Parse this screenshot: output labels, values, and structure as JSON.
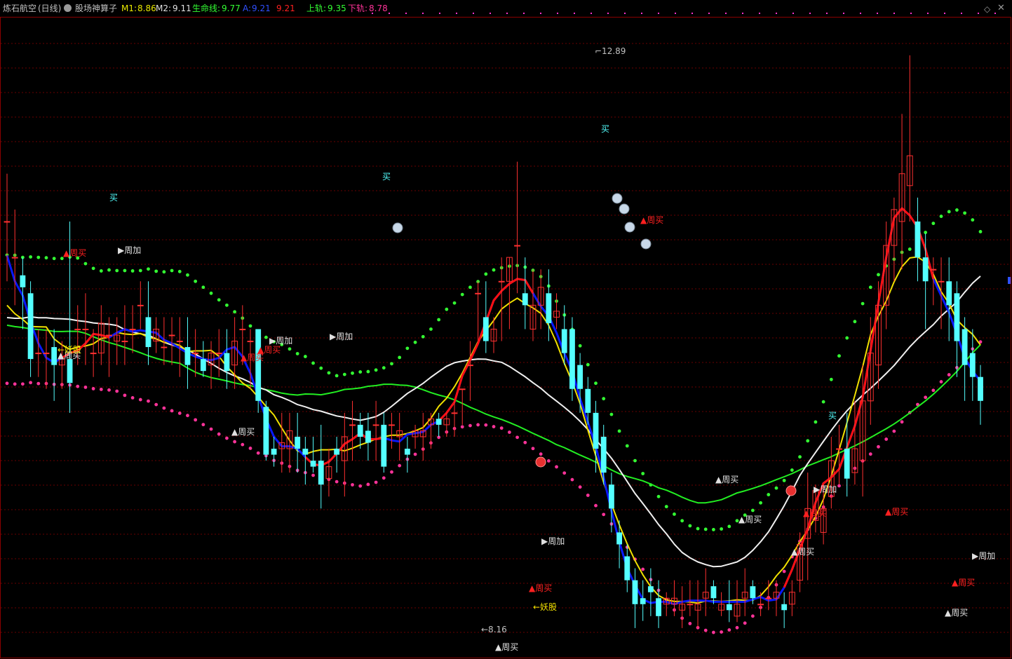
{
  "header": {
    "stock_name": "炼石航空",
    "period": "(日线)",
    "indicator": "股场神算子",
    "m1_label": "M1:",
    "m1_value": "8.86",
    "m2_label": "M2:",
    "m2_value": "9.11",
    "life_label": "生命线:",
    "life_value": "9.77",
    "a_label": "A:",
    "a_value": "9.21",
    "a2_value": "9.21",
    "upper_label": "上轨:",
    "upper_value": "9.35",
    "lower_label": "下轨:",
    "lower_value": "8.78",
    "colors": {
      "stock": "#c0c0c0",
      "m1": "#e8e800",
      "m2": "#e0e0e0",
      "life": "#33ff33",
      "a": "#3050ff",
      "a2": "#ff2020",
      "upper": "#33ff33",
      "lower": "#ff3399"
    }
  },
  "window_controls": {
    "diamond_icon": "diamond-icon",
    "close_icon": "close-icon"
  },
  "chart_data": {
    "type": "candlestick",
    "annotations": {
      "high_value": "12.89",
      "low_value": "8.16",
      "buy": "买",
      "week_buy": "周买",
      "week_add": "周加",
      "demon": "妖股"
    },
    "price_range": [
      7.9,
      13.2
    ],
    "colors": {
      "up": "#ff3030",
      "down": "#54ffff",
      "grid": "#6a0000",
      "ma_white": "#f0f0f0",
      "ma_yellow": "#f0e000",
      "ma_green": "#22ee22",
      "ma_blue": "#0818ff",
      "ma_red": "#ff1010",
      "dots_green": "#33ff33",
      "dots_pink": "#ff3399"
    },
    "candles": [
      [
        11.5,
        11.5,
        11.0,
        11.9
      ],
      [
        11.2,
        11.2,
        10.8,
        11.6
      ],
      [
        11.05,
        10.95,
        10.6,
        11.2
      ],
      [
        10.9,
        10.35,
        10.2,
        11.0
      ],
      [
        10.4,
        10.4,
        10.2,
        10.6
      ],
      [
        10.4,
        10.4,
        10.1,
        10.6
      ],
      [
        10.45,
        10.3,
        10.0,
        10.6
      ],
      [
        10.3,
        10.35,
        10.1,
        10.5
      ],
      [
        10.35,
        10.15,
        9.9,
        11.5
      ],
      [
        10.6,
        10.6,
        10.3,
        10.8
      ],
      [
        10.6,
        10.6,
        10.3,
        10.9
      ],
      [
        10.4,
        10.4,
        10.2,
        10.6
      ],
      [
        10.4,
        10.65,
        10.3,
        10.8
      ],
      [
        10.55,
        10.55,
        10.2,
        10.7
      ],
      [
        10.5,
        10.55,
        10.3,
        10.7
      ],
      [
        10.5,
        10.5,
        10.3,
        10.8
      ],
      [
        10.6,
        10.6,
        10.4,
        10.8
      ],
      [
        10.8,
        10.8,
        10.6,
        11.0
      ],
      [
        10.7,
        10.45,
        10.3,
        11.0
      ],
      [
        10.5,
        10.6,
        10.4,
        10.7
      ],
      [
        10.45,
        10.45,
        10.3,
        10.7
      ],
      [
        10.55,
        10.55,
        10.3,
        10.7
      ],
      [
        10.5,
        10.5,
        10.2,
        10.7
      ],
      [
        10.45,
        10.3,
        10.1,
        10.7
      ],
      [
        10.4,
        10.4,
        10.2,
        10.6
      ],
      [
        10.35,
        10.25,
        10.2,
        10.5
      ],
      [
        10.3,
        10.4,
        10.1,
        10.5
      ],
      [
        10.4,
        10.4,
        10.2,
        10.6
      ],
      [
        10.4,
        10.25,
        10.1,
        10.6
      ],
      [
        10.3,
        10.5,
        10.1,
        10.7
      ],
      [
        10.6,
        10.6,
        10.3,
        10.8
      ],
      [
        10.5,
        10.5,
        10.1,
        10.6
      ],
      [
        10.6,
        10.0,
        9.9,
        10.6
      ],
      [
        9.95,
        9.55,
        9.5,
        10.0
      ],
      [
        9.6,
        9.55,
        9.45,
        9.7
      ],
      [
        9.6,
        9.65,
        9.4,
        9.9
      ],
      [
        9.6,
        9.75,
        9.4,
        9.9
      ],
      [
        9.7,
        9.6,
        9.4,
        9.9
      ],
      [
        9.6,
        9.55,
        9.3,
        9.7
      ],
      [
        9.5,
        9.45,
        9.4,
        9.7
      ],
      [
        9.5,
        9.3,
        9.1,
        9.8
      ],
      [
        9.35,
        9.45,
        9.2,
        9.6
      ],
      [
        9.6,
        9.55,
        9.4,
        9.7
      ],
      [
        9.5,
        9.7,
        9.2,
        9.9
      ],
      [
        9.8,
        9.8,
        9.5,
        10.0
      ],
      [
        9.8,
        9.7,
        9.6,
        9.9
      ],
      [
        9.75,
        9.65,
        9.5,
        9.9
      ],
      [
        9.8,
        9.8,
        9.5,
        10.0
      ],
      [
        9.8,
        9.45,
        9.4,
        9.9
      ],
      [
        9.8,
        9.8,
        9.6,
        9.9
      ],
      [
        9.7,
        9.75,
        9.5,
        9.9
      ],
      [
        9.6,
        9.55,
        9.4,
        9.7
      ],
      [
        9.7,
        9.75,
        9.6,
        9.8
      ],
      [
        9.7,
        9.75,
        9.5,
        9.9
      ],
      [
        9.8,
        9.85,
        9.6,
        9.9
      ],
      [
        9.85,
        9.8,
        9.7,
        9.9
      ],
      [
        9.8,
        9.85,
        9.7,
        9.9
      ],
      [
        9.9,
        9.9,
        9.7,
        10.0
      ],
      [
        10.1,
        10.1,
        9.8,
        10.1
      ],
      [
        10.3,
        10.3,
        10.0,
        10.5
      ],
      [
        10.9,
        10.9,
        10.5,
        11.0
      ],
      [
        10.7,
        10.5,
        10.4,
        11.0
      ],
      [
        10.5,
        10.6,
        10.4,
        10.7
      ],
      [
        11.0,
        11.0,
        10.5,
        11.2
      ],
      [
        11.0,
        11.2,
        10.6,
        11.2
      ],
      [
        11.3,
        11.3,
        10.9,
        12.0
      ],
      [
        10.9,
        10.8,
        10.6,
        11.2
      ],
      [
        10.6,
        10.8,
        10.5,
        11.1
      ],
      [
        10.8,
        10.95,
        10.6,
        11.1
      ],
      [
        10.9,
        10.65,
        10.5,
        11.1
      ],
      [
        10.7,
        10.75,
        10.6,
        10.9
      ],
      [
        10.6,
        10.4,
        10.3,
        10.8
      ],
      [
        10.6,
        10.1,
        10.0,
        10.7
      ],
      [
        10.3,
        10.1,
        9.9,
        10.4
      ],
      [
        10.1,
        9.9,
        9.8,
        10.2
      ],
      [
        9.9,
        9.6,
        9.4,
        10.0
      ],
      [
        9.7,
        9.4,
        9.3,
        9.8
      ],
      [
        9.3,
        9.1,
        8.9,
        9.4
      ],
      [
        8.9,
        8.8,
        8.6,
        9.0
      ],
      [
        8.7,
        8.5,
        8.4,
        8.8
      ],
      [
        8.5,
        8.3,
        8.1,
        8.6
      ],
      [
        8.35,
        8.3,
        8.16,
        8.5
      ],
      [
        8.45,
        8.4,
        8.2,
        8.6
      ],
      [
        8.35,
        8.2,
        8.1,
        8.5
      ],
      [
        8.3,
        8.35,
        8.2,
        8.4
      ],
      [
        8.3,
        8.35,
        8.2,
        8.5
      ],
      [
        8.25,
        8.3,
        8.1,
        8.45
      ],
      [
        8.3,
        8.3,
        8.2,
        8.5
      ],
      [
        8.25,
        8.3,
        8.1,
        8.5
      ],
      [
        8.35,
        8.4,
        8.2,
        8.6
      ],
      [
        8.45,
        8.35,
        8.3,
        8.5
      ],
      [
        8.25,
        8.3,
        8.2,
        8.4
      ],
      [
        8.3,
        8.25,
        8.15,
        8.5
      ],
      [
        8.2,
        8.3,
        8.15,
        8.5
      ],
      [
        8.35,
        8.4,
        8.2,
        8.6
      ],
      [
        8.45,
        8.35,
        8.3,
        8.5
      ],
      [
        8.3,
        8.3,
        8.2,
        8.4
      ],
      [
        8.35,
        8.35,
        8.25,
        8.5
      ],
      [
        8.35,
        8.4,
        8.2,
        8.5
      ],
      [
        8.3,
        8.25,
        8.1,
        8.4
      ],
      [
        8.3,
        8.4,
        8.2,
        8.5
      ],
      [
        8.5,
        8.8,
        8.4,
        8.9
      ],
      [
        8.85,
        9.1,
        8.5,
        9.4
      ],
      [
        9.0,
        9.25,
        8.9,
        9.3
      ],
      [
        8.9,
        9.1,
        8.8,
        9.3
      ],
      [
        9.2,
        9.5,
        9.1,
        9.7
      ],
      [
        9.6,
        9.6,
        9.3,
        9.8
      ],
      [
        9.6,
        9.35,
        9.2,
        9.9
      ],
      [
        9.4,
        9.6,
        9.3,
        10.0
      ],
      [
        9.5,
        10.0,
        9.2,
        10.3
      ],
      [
        10.0,
        10.4,
        9.8,
        10.7
      ],
      [
        10.3,
        10.8,
        10.1,
        11.0
      ],
      [
        10.8,
        11.3,
        10.6,
        11.5
      ],
      [
        11.3,
        11.6,
        11.0,
        11.7
      ],
      [
        11.5,
        11.9,
        11.1,
        12.4
      ],
      [
        11.8,
        12.05,
        11.5,
        12.89
      ],
      [
        11.5,
        11.2,
        11.0,
        11.7
      ],
      [
        11.2,
        11.0,
        10.6,
        11.4
      ],
      [
        11.1,
        11.1,
        10.8,
        11.2
      ],
      [
        11.0,
        11.0,
        10.6,
        11.2
      ],
      [
        11.0,
        10.8,
        10.5,
        11.2
      ],
      [
        10.9,
        10.5,
        10.2,
        11.0
      ],
      [
        10.6,
        10.3,
        10.0,
        10.7
      ],
      [
        10.4,
        10.2,
        10.0,
        10.6
      ],
      [
        10.2,
        10.0,
        9.8,
        10.3
      ]
    ]
  }
}
